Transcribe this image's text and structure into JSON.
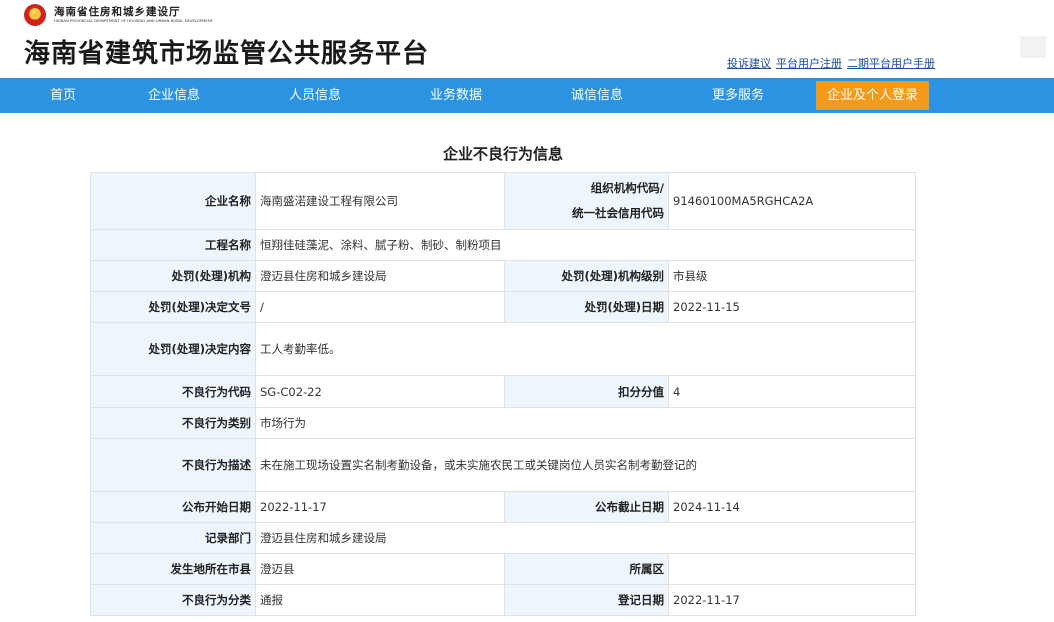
{
  "header": {
    "dept_cn": "海南省住房和城乡建设厅",
    "dept_en": "HAINAN PROVINCIAL DEPARTMENT OF HOUSING AND URBAN-RURAL DEVELOPMENT",
    "site_title": "海南省建筑市场监管公共服务平台",
    "links": [
      "投诉建议",
      "平台用户注册",
      "二期平台用户手册"
    ]
  },
  "nav": {
    "items": [
      "首页",
      "企业信息",
      "人员信息",
      "业务数据",
      "诚信信息",
      "更多服务"
    ],
    "login": "企业及个人登录"
  },
  "page_heading": "企业不良行为信息",
  "record": {
    "company_name_label": "企业名称",
    "company_name": "海南盛渃建设工程有限公司",
    "org_code_label_1": "组织机构代码/",
    "org_code_label_2": "统一社会信用代码",
    "org_code": "91460100MA5RGHCA2A",
    "project_name_label": "工程名称",
    "project_name": "恒翔佳硅藻泥、涂料、腻子粉、制砂、制粉项目",
    "penalty_agency_label": "处罚(处理)机构",
    "penalty_agency": "澄迈县住房和城乡建设局",
    "agency_level_label": "处罚(处理)机构级别",
    "agency_level": "市县级",
    "decision_no_label": "处罚(处理)决定文号",
    "decision_no": "/",
    "decision_date_label": "处罚(处理)日期",
    "decision_date": "2022-11-15",
    "decision_content_label": "处罚(处理)决定内容",
    "decision_content": "工人考勤率低。",
    "behavior_code_label": "不良行为代码",
    "behavior_code": "SG-C02-22",
    "deduction_label": "扣分分值",
    "deduction": "4",
    "behavior_type_label": "不良行为类别",
    "behavior_type": "市场行为",
    "behavior_desc_label": "不良行为描述",
    "behavior_desc": "未在施工现场设置实名制考勤设备，或未实施农民工或关键岗位人员实名制考勤登记的",
    "publish_start_label": "公布开始日期",
    "publish_start": "2022-11-17",
    "publish_end_label": "公布截止日期",
    "publish_end": "2024-11-14",
    "record_dept_label": "记录部门",
    "record_dept": "澄迈县住房和城乡建设局",
    "city_label": "发生地所在市县",
    "city": "澄迈县",
    "district_label": "所属区",
    "district": "",
    "behavior_class_label": "不良行为分类",
    "behavior_class": "通报",
    "register_date_label": "登记日期",
    "register_date": "2022-11-17"
  }
}
